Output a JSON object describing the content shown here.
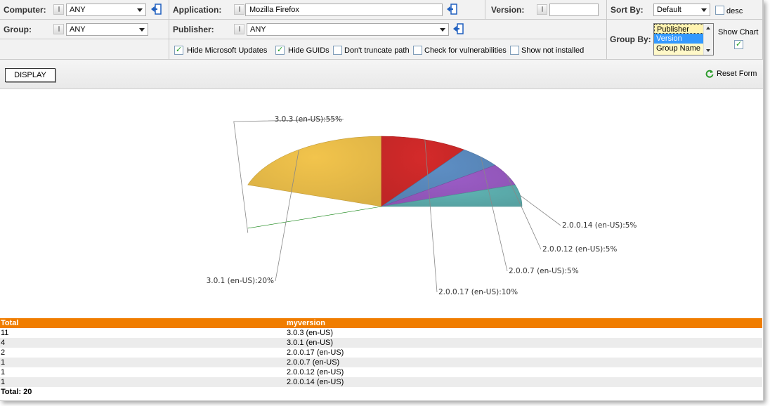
{
  "filters": {
    "computer": {
      "label": "Computer:",
      "value": "ANY"
    },
    "group": {
      "label": "Group:",
      "value": "ANY"
    },
    "application": {
      "label": "Application:",
      "value": "Mozilla Firefox"
    },
    "publisher": {
      "label": "Publisher:",
      "value": "ANY"
    },
    "version": {
      "label": "Version:",
      "value": ""
    },
    "sort_by": {
      "label": "Sort By:",
      "value": "Default",
      "desc_label": "desc",
      "desc_checked": false
    },
    "group_by": {
      "label": "Group By:",
      "options": [
        "Publisher",
        "Version",
        "Group Name"
      ],
      "selected": "Version"
    },
    "show_chart": {
      "label": "Show Chart",
      "checked": true
    },
    "checkboxes": [
      {
        "label": "Hide Microsoft Updates",
        "checked": true
      },
      {
        "label": "Hide GUIDs",
        "checked": true
      },
      {
        "label": "Don't truncate path",
        "checked": false
      },
      {
        "label": "Check for vulnerabilities",
        "checked": false
      },
      {
        "label": "Show not installed",
        "checked": false
      }
    ]
  },
  "toolbar": {
    "display_label": "DISPLAY",
    "reset_label": "Reset Form"
  },
  "chart_data": {
    "type": "pie",
    "title": "",
    "slices": [
      {
        "label": "3.0.3 (en-US):55%",
        "value": 55,
        "color": "#12a312"
      },
      {
        "label": "3.0.1 (en-US):20%",
        "value": 20,
        "color": "#f2c44c"
      },
      {
        "label": "2.0.0.17 (en-US):10%",
        "value": 10,
        "color": "#d42a2a"
      },
      {
        "label": "2.0.0.7 (en-US):5%",
        "value": 5,
        "color": "#5d8ec4"
      },
      {
        "label": "2.0.0.12 (en-US):5%",
        "value": 5,
        "color": "#9b5cc6"
      },
      {
        "label": "2.0.0.14 (en-US):5%",
        "value": 5,
        "color": "#5fb3b3"
      }
    ]
  },
  "table": {
    "headers": [
      "Total",
      "myversion"
    ],
    "rows": [
      [
        "11",
        "3.0.3 (en-US)"
      ],
      [
        "4",
        "3.0.1 (en-US)"
      ],
      [
        "2",
        "2.0.0.17 (en-US)"
      ],
      [
        "1",
        "2.0.0.7 (en-US)"
      ],
      [
        "1",
        "2.0.0.12 (en-US)"
      ],
      [
        "1",
        "2.0.0.14 (en-US)"
      ]
    ],
    "footer": "Total: 20"
  },
  "colors": {
    "header_orange": "#f07d00",
    "accent_blue": "#1f5fbf",
    "reset_green": "#2d9b2d"
  }
}
